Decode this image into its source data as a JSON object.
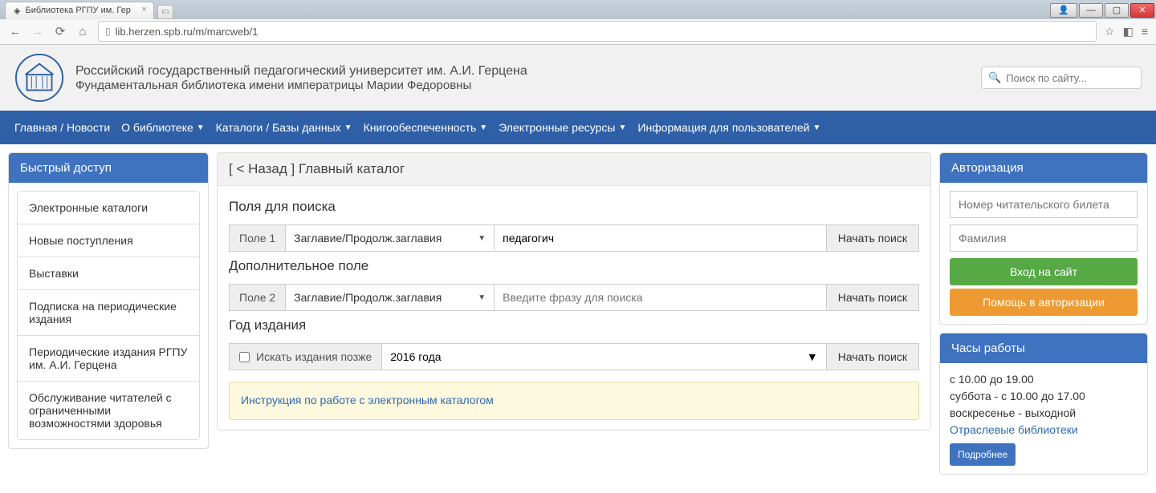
{
  "browser": {
    "tab_title": "Библиотека РГПУ им. Гер",
    "url": "lib.herzen.spb.ru/m/marcweb/1"
  },
  "header": {
    "line1": "Российский государственный педагогический университет им. А.И. Герцена",
    "line2": "Фундаментальная библиотека имени императрицы Марии Федоровны",
    "search_placeholder": "Поиск по сайту..."
  },
  "nav": {
    "items": [
      {
        "label": "Главная / Новости",
        "caret": false
      },
      {
        "label": "О библиотеке",
        "caret": true
      },
      {
        "label": "Каталоги / Базы данных",
        "caret": true
      },
      {
        "label": "Книгообеспеченность",
        "caret": true
      },
      {
        "label": "Электронные ресурсы",
        "caret": true
      },
      {
        "label": "Информация для пользователей",
        "caret": true
      }
    ]
  },
  "quick": {
    "title": "Быстрый доступ",
    "items": [
      "Электронные каталоги",
      "Новые поступления",
      "Выставки",
      "Подписка на периодические издания",
      "Периодические издания РГПУ им. А.И. Герцена",
      "Обслуживание читателей с ограниченными возможностями здоровья"
    ]
  },
  "main": {
    "heading": "[ < Назад ] Главный каталог",
    "section1": "Поля для поиска",
    "field1_addon": "Поле 1",
    "field1_select": "Заглавие/Продолж.заглавия",
    "field1_value": "педагогич",
    "section2": "Дополнительное поле",
    "field2_addon": "Поле 2",
    "field2_select": "Заглавие/Продолж.заглавия",
    "field2_placeholder": "Введите фразу для поиска",
    "section3": "Год издания",
    "check_label": "Искать издания позже",
    "year_select": "2016 года",
    "search_btn": "Начать поиск",
    "instruction": "Инструкция по работе с электронным каталогом"
  },
  "auth": {
    "title": "Авторизация",
    "card_placeholder": "Номер читательского билета",
    "lastname_placeholder": "Фамилия",
    "login_btn": "Вход на сайт",
    "help_btn": "Помощь в авторизации"
  },
  "hours": {
    "title": "Часы работы",
    "line1": "с 10.00 до 19.00",
    "line2": "суббота - с 10.00 до 17.00",
    "line3": "воскресенье - выходной",
    "link": "Отраслевые библиотеки",
    "more": "Подробнее"
  }
}
